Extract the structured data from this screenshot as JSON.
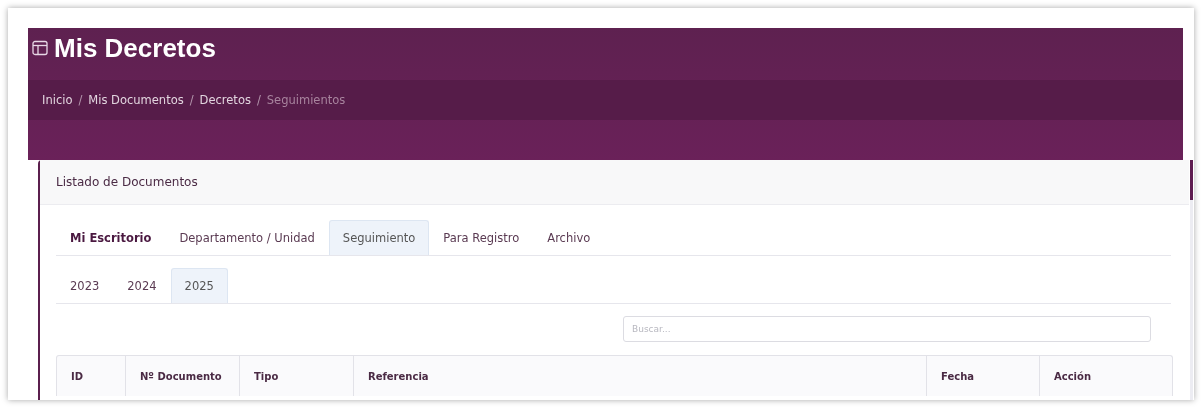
{
  "header": {
    "title": "Mis Decretos"
  },
  "breadcrumb_separator": "/",
  "breadcrumb": [
    {
      "label": "Inicio",
      "current": false
    },
    {
      "label": "Mis Documentos",
      "current": false
    },
    {
      "label": "Decretos",
      "current": false
    },
    {
      "label": "Seguimientos",
      "current": true
    }
  ],
  "card": {
    "title": "Listado de Documentos"
  },
  "tabs": [
    {
      "label": "Mi Escritorio",
      "selected": false,
      "emphasized": true
    },
    {
      "label": "Departamento / Unidad",
      "selected": false,
      "emphasized": false
    },
    {
      "label": "Seguimiento",
      "selected": true,
      "emphasized": false
    },
    {
      "label": "Para Registro",
      "selected": false,
      "emphasized": false
    },
    {
      "label": "Archivo",
      "selected": false,
      "emphasized": false
    }
  ],
  "year_tabs": [
    {
      "label": "2023",
      "selected": false
    },
    {
      "label": "2024",
      "selected": false
    },
    {
      "label": "2025",
      "selected": true
    }
  ],
  "search": {
    "placeholder": "Buscar..."
  },
  "table": {
    "columns": [
      "ID",
      "Nº Documento",
      "Tipo",
      "Referencia",
      "Fecha",
      "Acción"
    ]
  }
}
